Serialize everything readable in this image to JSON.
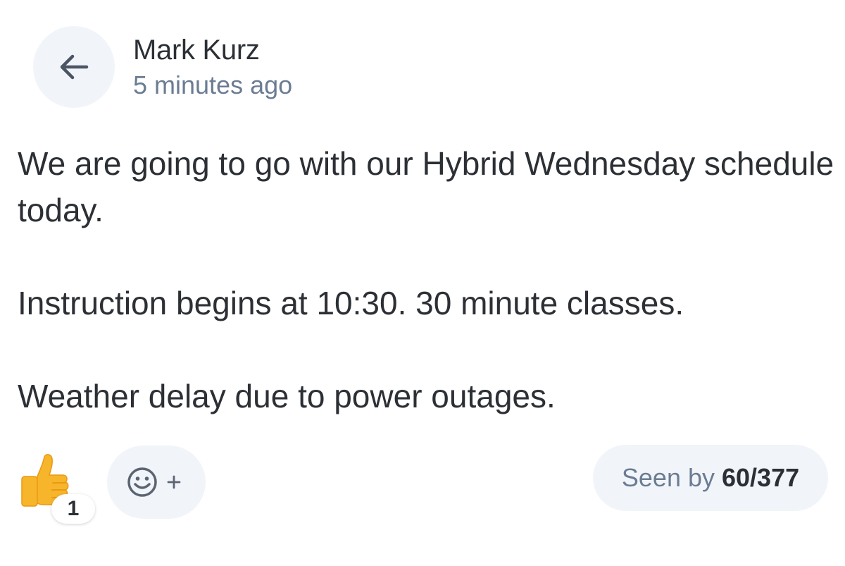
{
  "header": {
    "back_icon": "arrow-left-icon",
    "author": "Mark Kurz",
    "timestamp": "5 minutes ago"
  },
  "message": {
    "paragraphs": [
      "We are going to go with our Hybrid Wednesday schedule today.",
      "Instruction begins at 10:30. 30 minute classes.",
      "Weather delay due to power outages."
    ]
  },
  "reactions": [
    {
      "emoji": "thumbs-up-icon",
      "count": "1"
    }
  ],
  "add_reaction": {
    "icon": "smiley-plus-icon"
  },
  "seen_by": {
    "label": "Seen by",
    "count": "60/377"
  },
  "colors": {
    "pill_background": "#f1f5f9",
    "muted_text": "#6b7c93",
    "body_text": "#2c3035",
    "thumb_yellow": "#f7b52b"
  }
}
